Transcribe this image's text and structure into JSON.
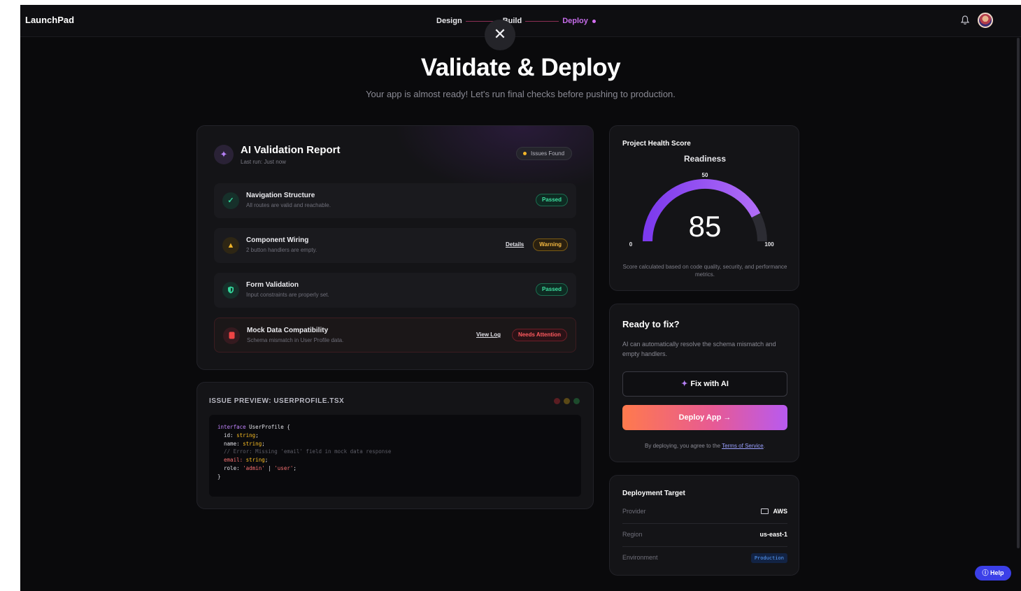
{
  "app": {
    "brand": "LaunchPad"
  },
  "steps": [
    {
      "label": "Design"
    },
    {
      "label": "Build"
    },
    {
      "label": "Deploy"
    }
  ],
  "close_glyph": "✕",
  "header": {
    "title": "Validate & Deploy",
    "subtitle": "Your app is almost ready! Let's run final checks before pushing to production."
  },
  "validation": {
    "title": "AI Validation Report",
    "last_run": "Last run: Just now",
    "status_badge": "Issues Found",
    "checks": [
      {
        "title": "Navigation Structure",
        "desc": "All routes are valid and reachable.",
        "status": "Passed",
        "icon": "check-icon"
      },
      {
        "title": "Component Wiring",
        "desc": "2 button handlers are empty.",
        "status": "Warning",
        "link": "Details",
        "icon": "warning-icon"
      },
      {
        "title": "Form Validation",
        "desc": "Input constraints are properly set.",
        "status": "Passed",
        "icon": "shield-icon"
      },
      {
        "title": "Mock Data Compatibility",
        "desc": "Schema mismatch in User Profile data.",
        "status": "Needs Attention",
        "link": "View Log",
        "icon": "database-icon"
      }
    ]
  },
  "issue_preview": {
    "title": "ISSUE PREVIEW: USERPROFILE.TSX",
    "code": {
      "l1_kw": "interface",
      "l1_rest": " UserProfile {",
      "l2_prop": "id:",
      "l2_type": " string",
      "l3_prop": "name:",
      "l3_type": " string",
      "l4_comment": "// Error: Missing 'email' field in mock data response",
      "l5_prop": "email:",
      "l5_type": " string",
      "l6_prop": "role:",
      "l6_a": " 'admin'",
      "l6_sep": " | ",
      "l6_b": "'user'",
      "l7": "}"
    }
  },
  "health": {
    "title": "Project Health Score",
    "gauge_label": "Readiness",
    "score": 85,
    "min_label": "0",
    "mid_label": "50",
    "max_label": "100",
    "note": "Score calculated based on code quality, security, and performance metrics."
  },
  "fix": {
    "title": "Ready to fix?",
    "desc": "AI can automatically resolve the schema mismatch and empty handlers.",
    "fix_button": "Fix with AI",
    "deploy_button": "Deploy App →",
    "terms_prefix": "By deploying, you agree to the ",
    "terms_link": "Terms of Service",
    "terms_suffix": "."
  },
  "target": {
    "title": "Deployment Target",
    "provider_label": "Provider",
    "provider_value": "AWS",
    "region_label": "Region",
    "region_value": "us-east-1",
    "environment_label": "Environment",
    "environment_value": "Production"
  },
  "help": {
    "label": "Help"
  },
  "colors": {
    "accent_purple": "#a855f7",
    "passed_green": "#3ee0a0",
    "warning_amber": "#f5b941",
    "attention_red": "#ff5a5f",
    "deploy_gradient_start": "#ff7a4d",
    "deploy_gradient_end": "#b85af0"
  }
}
